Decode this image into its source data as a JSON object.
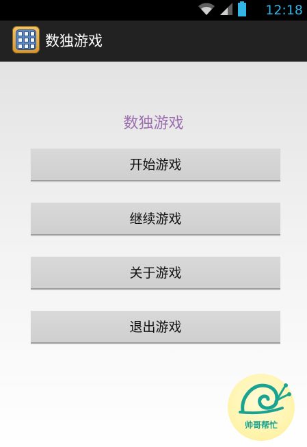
{
  "status_bar": {
    "time": "12:18",
    "icons": [
      "wifi-icon",
      "signal-icon",
      "battery-icon"
    ],
    "accent_color": "#33b5e5"
  },
  "action_bar": {
    "title": "数独游戏",
    "app_icon": "sudoku-app-icon"
  },
  "main": {
    "title": "数独游戏",
    "title_color": "#9c6dae",
    "buttons": [
      {
        "label": "开始游戏"
      },
      {
        "label": "继续游戏"
      },
      {
        "label": "关于游戏"
      },
      {
        "label": "退出游戏"
      }
    ]
  },
  "watermark": {
    "text": "帅哥帮忙",
    "icon": "snail-logo-icon",
    "color": "#1aa390"
  }
}
